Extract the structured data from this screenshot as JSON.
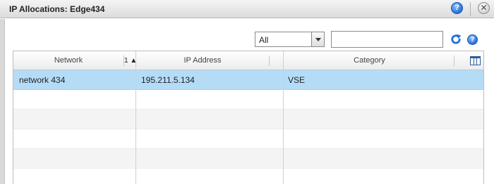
{
  "window": {
    "title": "IP Allocations: Edge434",
    "help_glyph": "?",
    "close_glyph": "✕"
  },
  "toolbar": {
    "filter_value": "All",
    "search_value": "",
    "help_glyph": "?"
  },
  "grid": {
    "columns": [
      "Network",
      "IP Address",
      "Category"
    ],
    "sort_indicator": "1 ▲",
    "rows": [
      [
        "network 434",
        "195.211.5.134",
        "VSE"
      ]
    ]
  }
}
